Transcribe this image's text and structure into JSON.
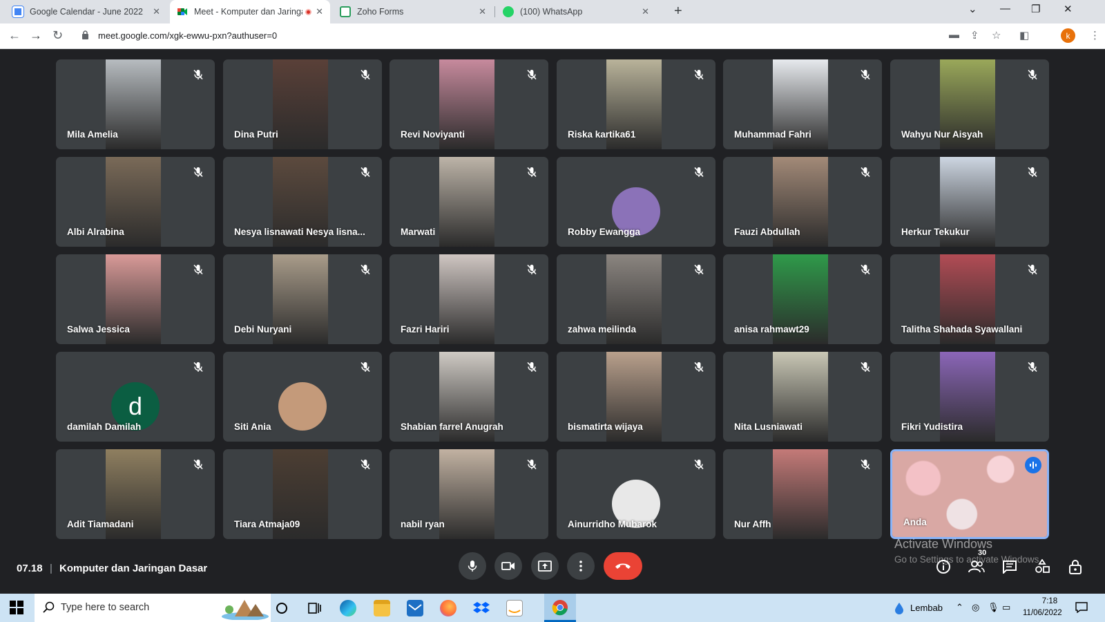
{
  "browser": {
    "tabs": [
      {
        "title": "Google Calendar - June 2022",
        "icon": "google-calendar-icon",
        "active": false
      },
      {
        "title": "Meet - Komputer dan Jaringan",
        "icon": "google-meet-icon",
        "active": true,
        "recording": true
      },
      {
        "title": "Zoho Forms",
        "icon": "zoho-forms-icon",
        "active": false
      },
      {
        "title": "(100) WhatsApp",
        "icon": "whatsapp-icon",
        "active": false
      }
    ],
    "url": "meet.google.com/xgk-ewwu-pxn?authuser=0",
    "profile_initial": "k"
  },
  "meet": {
    "participants": [
      {
        "name": "Mila Amelia",
        "tone": "#b7bcc0"
      },
      {
        "name": "Dina Putri",
        "tone": "#5a4038"
      },
      {
        "name": "Revi Noviyanti",
        "tone": "#c78a9d"
      },
      {
        "name": "Riska kartika61",
        "tone": "#b9b39a"
      },
      {
        "name": "Muhammad Fahri",
        "tone": "#e7eaee"
      },
      {
        "name": "Wahyu Nur Aisyah",
        "tone": "#9aa85a"
      },
      {
        "name": "Albi Alrabina",
        "tone": "#7a6a58"
      },
      {
        "name": "Nesya lisnawati Nesya lisna...",
        "tone": "#5c4a3e"
      },
      {
        "name": "Marwati",
        "tone": "#bdb4a8"
      },
      {
        "name": "Robby Ewangga",
        "tone": "#3c4043",
        "avatar": true,
        "avatar_color": "#8b72b8"
      },
      {
        "name": "Fauzi Abdullah",
        "tone": "#a38a78"
      },
      {
        "name": "Herkur Tekukur",
        "tone": "#cdd6e2"
      },
      {
        "name": "Salwa Jessica",
        "tone": "#d99a98"
      },
      {
        "name": "Debi Nuryani",
        "tone": "#a99c8a"
      },
      {
        "name": "Fazri Hariri",
        "tone": "#cfc6c2"
      },
      {
        "name": "zahwa meilinda",
        "tone": "#8b8580"
      },
      {
        "name": "anisa rahmawt29",
        "tone": "#2f9a4a"
      },
      {
        "name": "Talitha Shahada Syawallani",
        "tone": "#b24c55"
      },
      {
        "name": "damilah Damilah",
        "tone": "#3c4043",
        "avatar": true,
        "avatar_color": "#0b5e42",
        "avatar_letter": "d"
      },
      {
        "name": "Siti Ania",
        "tone": "#3c4043",
        "avatar": true,
        "avatar_color": "#c49a7a"
      },
      {
        "name": "Shabian farrel Anugrah",
        "tone": "#cfcac4"
      },
      {
        "name": "bismatirta wijaya",
        "tone": "#b9a08c"
      },
      {
        "name": "Nita Lusniawati",
        "tone": "#c9c7b5"
      },
      {
        "name": "Fikri Yudistira",
        "tone": "#8b66b8"
      },
      {
        "name": "Adit Tiamadani",
        "tone": "#8f7f60"
      },
      {
        "name": "Tiara Atmaja09",
        "tone": "#4c3e33"
      },
      {
        "name": "nabil ryan",
        "tone": "#c2b2a2"
      },
      {
        "name": "Ainurridho Mubarok",
        "tone": "#3c4043",
        "avatar": true,
        "avatar_color": "#e8e8e8"
      },
      {
        "name": "Nur Affh",
        "tone": "#c47a78"
      },
      {
        "name": "Anda",
        "tone": "#d9a8a4",
        "self": true
      }
    ],
    "time": "07.18",
    "separator": "|",
    "meeting_title": "Komputer dan Jaringan Dasar",
    "participant_count": "30",
    "controls": {
      "mic": "mic-icon",
      "camera": "camera-icon",
      "present": "present-screen-icon",
      "more": "more-options-icon",
      "leave": "leave-call-icon"
    },
    "right_controls": [
      "info-icon",
      "people-icon",
      "chat-icon",
      "activities-icon",
      "host-controls-icon"
    ]
  },
  "watermark": {
    "line1": "Activate Windows",
    "line2": "Go to Settings to activate Windows."
  },
  "taskbar": {
    "search_placeholder": "Type here to search",
    "weather": "Lembab",
    "time": "7:18",
    "date": "11/06/2022",
    "apps": [
      "task-view-icon",
      "edge-icon",
      "file-explorer-icon",
      "mail-icon",
      "firefox-icon",
      "dropbox-icon",
      "amazon-icon",
      "chrome-icon"
    ]
  },
  "colors": {
    "meet_bg": "#202124",
    "tile_bg": "#3c4043",
    "end_call": "#ea4335",
    "active_speaker": "#8ab4f8"
  }
}
